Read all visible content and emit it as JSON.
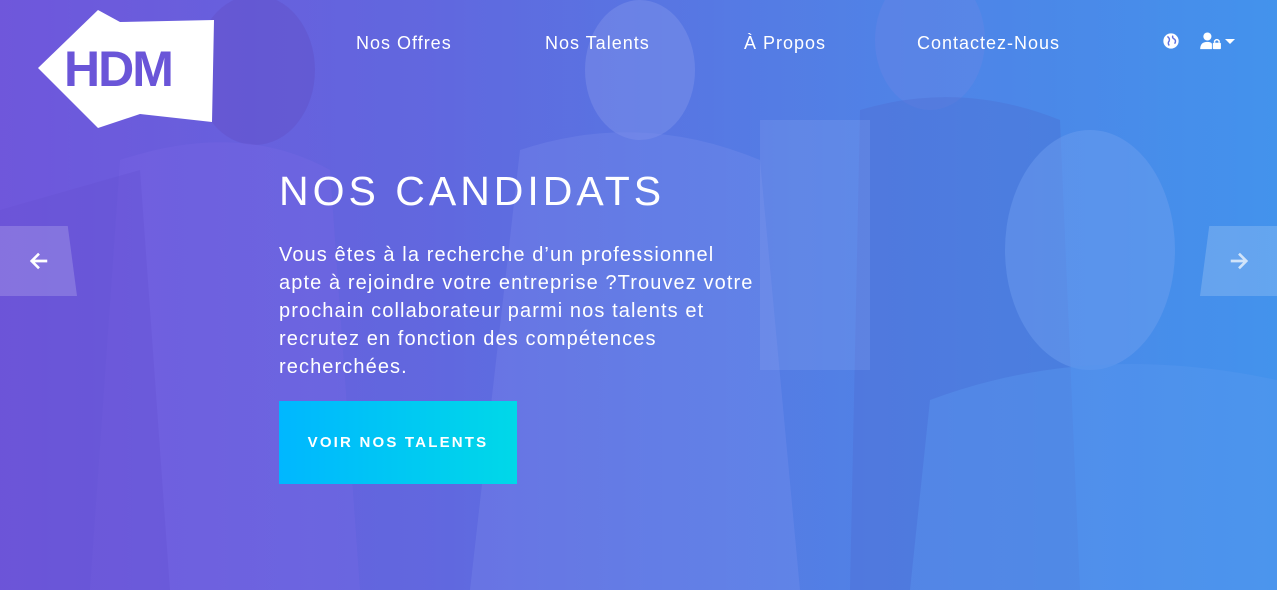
{
  "brand": {
    "logo_text": "HDM"
  },
  "nav": {
    "items": [
      {
        "label": "Nos Offres"
      },
      {
        "label": "Nos Talents"
      },
      {
        "label": "À Propos"
      },
      {
        "label": "Contactez-Nous"
      }
    ],
    "icons": [
      "globe-icon",
      "user-lock-icon",
      "caret-down-icon"
    ]
  },
  "hero": {
    "title": "NOS CANDIDATS",
    "description": "Vous êtes à la recherche d’un professionnel apte à rejoindre votre entreprise ?Trouvez votre prochain collaborateur parmi nos talents et recrutez en fonction des compétences recherchées.",
    "cta_label": "VOIR NOS TALENTS"
  },
  "carousel": {
    "prev_icon": "arrow-left-icon",
    "next_icon": "arrow-right-icon"
  },
  "colors": {
    "gradient_left": "#6d55d9",
    "gradient_right": "#3f9ff0",
    "cta_left": "#00b7ff",
    "cta_right": "#00d8e8",
    "text": "#ffffff"
  }
}
